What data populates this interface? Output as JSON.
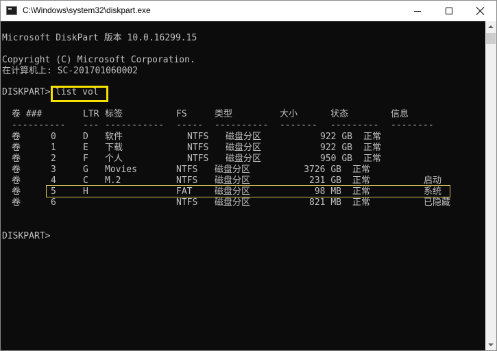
{
  "window": {
    "title": "C:\\Windows\\system32\\diskpart.exe"
  },
  "console": {
    "version_line": "Microsoft DiskPart 版本 10.0.16299.15",
    "copyright_line": "Copyright (C) Microsoft Corporation.",
    "computer_line": "在计算机上: SC-201701060002",
    "prompt": "DISKPART> ",
    "command": "list vol",
    "final_prompt": "DISKPART> "
  },
  "table": {
    "headers": {
      "vol": "卷 ###",
      "ltr": "LTR",
      "label": "标签",
      "fs": "FS",
      "type": "类型",
      "size": "大小",
      "status": "状态",
      "info": "信息"
    },
    "separators": {
      "vol": "----------",
      "ltr": "---",
      "label": "-----------",
      "fs": "-----",
      "type": "----------",
      "size": "-------",
      "status": "---------",
      "info": "--------"
    },
    "rows": [
      {
        "vol": "卷",
        "num": "0",
        "ltr": "D",
        "label": "软件",
        "fs": "NTFS",
        "type": "磁盘分区",
        "size": "922 GB",
        "status": "正常",
        "info": ""
      },
      {
        "vol": "卷",
        "num": "1",
        "ltr": "E",
        "label": "下载",
        "fs": "NTFS",
        "type": "磁盘分区",
        "size": "922 GB",
        "status": "正常",
        "info": ""
      },
      {
        "vol": "卷",
        "num": "2",
        "ltr": "F",
        "label": "个人",
        "fs": "NTFS",
        "type": "磁盘分区",
        "size": "950 GB",
        "status": "正常",
        "info": ""
      },
      {
        "vol": "卷",
        "num": "3",
        "ltr": "G",
        "label": "Movies",
        "fs": "NTFS",
        "type": "磁盘分区",
        "size": "3726 GB",
        "status": "正常",
        "info": ""
      },
      {
        "vol": "卷",
        "num": "4",
        "ltr": "C",
        "label": "M.2",
        "fs": "NTFS",
        "type": "磁盘分区",
        "size": "231 GB",
        "status": "正常",
        "info": "启动"
      },
      {
        "vol": "卷",
        "num": "5",
        "ltr": "H",
        "label": "",
        "fs": "FAT",
        "type": "磁盘分区",
        "size": "98 MB",
        "status": "正常",
        "info": "系统"
      },
      {
        "vol": "卷",
        "num": "6",
        "ltr": "",
        "label": "",
        "fs": "NTFS",
        "type": "磁盘分区",
        "size": "821 MB",
        "status": "正常",
        "info": "已隐藏"
      }
    ]
  },
  "colors": {
    "console_bg": "#0c0c0c",
    "console_text": "#c0c0c0",
    "command_highlight": "#f5e000",
    "row_highlight": "#d8c65a"
  },
  "icons": {
    "app": "console-app-icon",
    "minimize": "minimize-icon",
    "maximize": "maximize-icon",
    "close": "close-icon"
  }
}
